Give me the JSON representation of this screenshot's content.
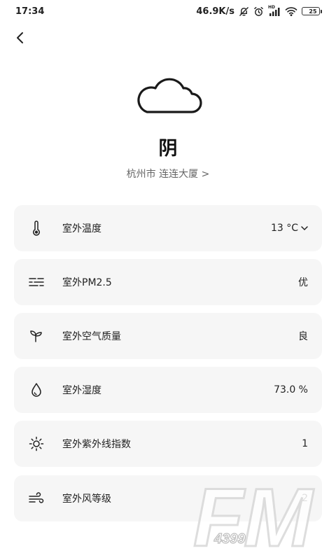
{
  "status_bar": {
    "time": "17:34",
    "net_speed": "46.9K/s",
    "hd_label": "HD",
    "battery_level": "25"
  },
  "weather": {
    "condition": "阴",
    "location": "杭州市 连连大厦 >",
    "icon": "cloud-icon"
  },
  "metrics": [
    {
      "label": "室外温度",
      "value": "13 °C",
      "icon": "thermometer-icon",
      "has_dropdown": true
    },
    {
      "label": "室外PM2.5",
      "value": "优",
      "icon": "haze-icon"
    },
    {
      "label": "室外空气质量",
      "value": "良",
      "icon": "sprout-icon"
    },
    {
      "label": "室外湿度",
      "value": "73.0 %",
      "icon": "droplet-icon"
    },
    {
      "label": "室外紫外线指数",
      "value": "1",
      "icon": "sun-icon"
    },
    {
      "label": "室外风等级",
      "value": "2",
      "icon": "wind-icon"
    }
  ],
  "watermark": {
    "brand": "FM",
    "number": "4399"
  },
  "colors": {
    "card_bg": "#f6f6f6",
    "text": "#222222",
    "subtext": "#666666",
    "battery": "#f2c200"
  }
}
